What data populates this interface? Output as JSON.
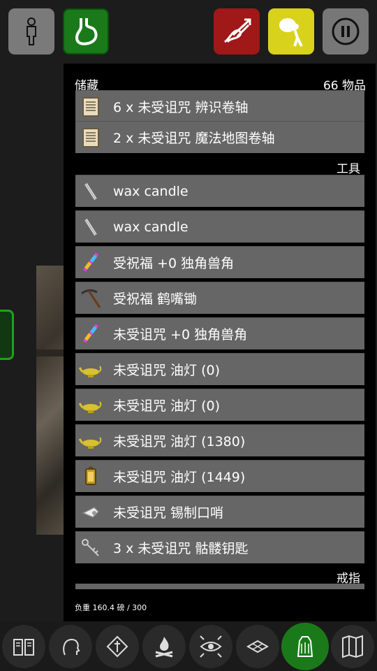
{
  "top_buttons": [
    {
      "name": "character-button",
      "icon": "person-icon",
      "color": "#7a7a7a"
    },
    {
      "name": "hunger-button",
      "icon": "stomach-icon",
      "color": "#1a7a1a"
    },
    {
      "name": "attack-button",
      "icon": "arrow-attack-icon",
      "color": "#a01818"
    },
    {
      "name": "pack-button",
      "icon": "backpack-icon",
      "color": "#d8d21c"
    },
    {
      "name": "pause-button",
      "icon": "pause-icon",
      "color": "#777777"
    }
  ],
  "inventory": {
    "title": "储藏",
    "count": "66 物品",
    "categories": {
      "tools": "工具",
      "rings": "戒指"
    },
    "items": [
      {
        "label": "6 x 未受诅咒 辨识卷轴",
        "icon": "scroll-icon"
      },
      {
        "label": "2 x 未受诅咒 魔法地图卷轴",
        "icon": "scroll-icon"
      },
      {
        "label": "wax candle",
        "icon": "candle-icon"
      },
      {
        "label": "wax candle",
        "icon": "candle-icon"
      },
      {
        "label": "受祝福 +0 独角兽角",
        "icon": "unicorn-horn-icon"
      },
      {
        "label": "受祝福 鹤嘴锄",
        "icon": "pickaxe-icon"
      },
      {
        "label": "未受诅咒 +0 独角兽角",
        "icon": "unicorn-horn-icon"
      },
      {
        "label": "未受诅咒 油灯 (0)",
        "icon": "oil-lamp-icon"
      },
      {
        "label": "未受诅咒 油灯 (0)",
        "icon": "oil-lamp-icon"
      },
      {
        "label": "未受诅咒 油灯 (1380)",
        "icon": "oil-lamp-icon"
      },
      {
        "label": "未受诅咒 油灯 (1449)",
        "icon": "lantern-icon"
      },
      {
        "label": "未受诅咒 锡制口哨",
        "icon": "whistle-icon"
      },
      {
        "label": "3 x 未受诅咒 骷髅钥匙",
        "icon": "key-icon"
      }
    ],
    "weight": "负重 160.4 磅 / 300"
  },
  "bottom_bar": [
    {
      "name": "spellbook-button",
      "icon": "book-icon"
    },
    {
      "name": "head-button",
      "icon": "head-icon"
    },
    {
      "name": "pray-button",
      "icon": "diamond-icon"
    },
    {
      "name": "fire-button",
      "icon": "campfire-icon"
    },
    {
      "name": "look-button",
      "icon": "eye-icon"
    },
    {
      "name": "floor-button",
      "icon": "tile-icon"
    },
    {
      "name": "inventory-button",
      "icon": "bag-icon",
      "active": true
    },
    {
      "name": "map-button",
      "icon": "map-icon"
    }
  ]
}
